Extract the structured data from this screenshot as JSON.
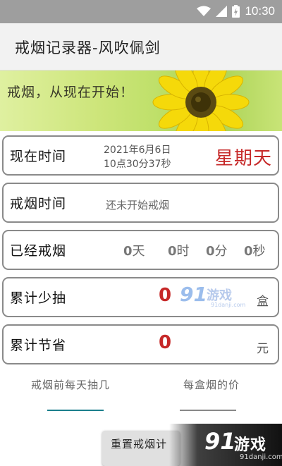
{
  "status_bar": {
    "time": "10:30",
    "icons": [
      "wifi-icon",
      "cell-signal-icon",
      "battery-charging-icon"
    ]
  },
  "app_bar": {
    "title": "戒烟记录器-风吹佩剑"
  },
  "banner": {
    "text": "戒烟，从现在开始！"
  },
  "cards": {
    "now": {
      "label": "现在时间",
      "date": "2021年6月6日",
      "time": "10点30分37秒",
      "weekday": "星期天"
    },
    "quit_time": {
      "label": "戒烟时间",
      "status": "还未开始戒烟"
    },
    "duration": {
      "label": "已经戒烟",
      "days_value": "0",
      "days_unit": "天",
      "hours_value": "0",
      "hours_unit": "时",
      "minutes_value": "0",
      "minutes_unit": "分",
      "seconds_value": "0",
      "seconds_unit": "秒"
    },
    "saved_packs": {
      "label": "累计少抽",
      "value": "0",
      "unit": "盒"
    },
    "saved_money": {
      "label": "累计节省",
      "value": "0",
      "unit": "元"
    }
  },
  "inputs": {
    "daily_smoked": {
      "label": "戒烟前每天抽几"
    },
    "pack_price": {
      "label": "每盒烟的价"
    }
  },
  "buttons": {
    "reset": "重置戒烟计"
  },
  "watermark": {
    "logo_number": "91",
    "logo_text": "游戏",
    "url": "91danji.com"
  },
  "colors": {
    "accent_red": "#c62828",
    "active_underline": "#1b7f8c",
    "status_bar": "#9e9e9e"
  }
}
